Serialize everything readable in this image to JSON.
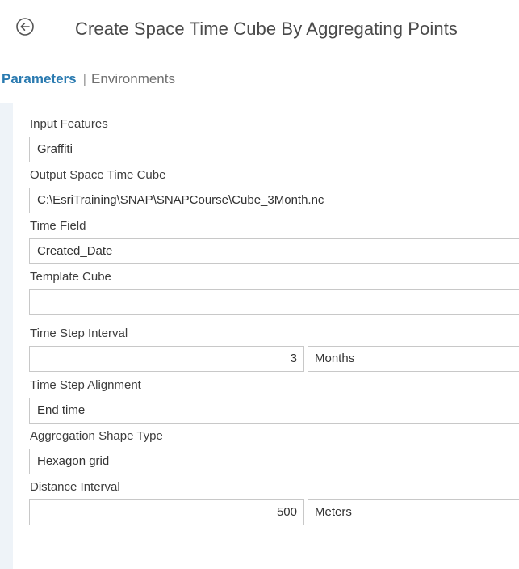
{
  "header": {
    "title": "Create Space Time Cube By Aggregating Points",
    "back_icon": "back-arrow-circle-icon"
  },
  "tabs": {
    "parameters": "Parameters",
    "separator": "|",
    "environments": "Environments"
  },
  "params": {
    "input_features": {
      "label": "Input Features",
      "value": "Graffiti"
    },
    "output_cube": {
      "label": "Output Space Time Cube",
      "value": "C:\\EsriTraining\\SNAP\\SNAPCourse\\Cube_3Month.nc"
    },
    "time_field": {
      "label": "Time Field",
      "value": "Created_Date"
    },
    "template_cube": {
      "label": "Template Cube",
      "value": ""
    },
    "time_step_interval": {
      "label": "Time Step Interval",
      "value": "3",
      "unit": "Months"
    },
    "time_step_alignment": {
      "label": "Time Step Alignment",
      "value": "End time"
    },
    "aggregation_shape": {
      "label": "Aggregation Shape Type",
      "value": "Hexagon grid"
    },
    "distance_interval": {
      "label": "Distance Interval",
      "value": "500",
      "unit": "Meters"
    }
  },
  "colors": {
    "accent": "#2a7ab0",
    "side_strip": "#eef3f8",
    "field_border": "#c8c8c8"
  }
}
